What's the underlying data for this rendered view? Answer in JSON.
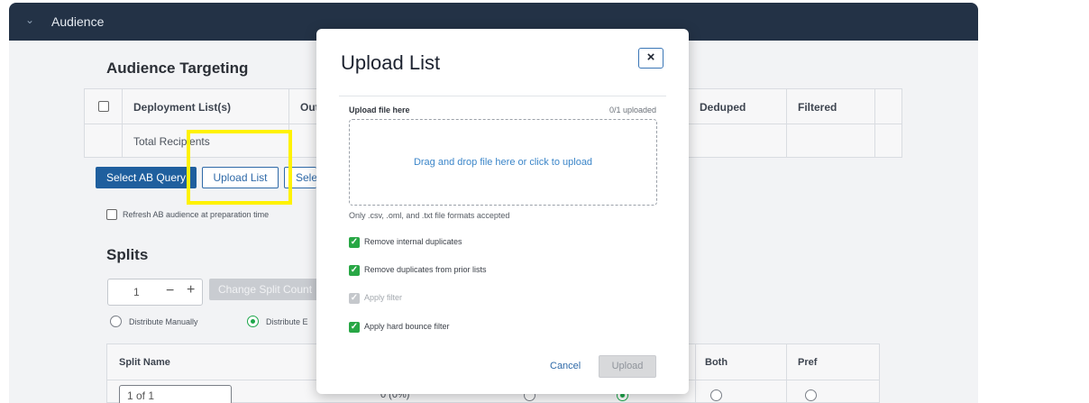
{
  "panel": {
    "title": "Audience"
  },
  "targeting": {
    "title": "Audience Targeting",
    "columns": [
      "Deployment List(s)",
      "Out",
      "Deduped",
      "Filtered"
    ],
    "row_label": "Total Recipients",
    "buttons": {
      "select_ab_query": "Select AB Query",
      "upload_list": "Upload List",
      "select_partial": "Sele"
    },
    "refresh_label": "Refresh AB audience at preparation time"
  },
  "splits": {
    "title": "Splits",
    "count_value": "1",
    "change_count_label": "Change Split Count",
    "distribute_manually": "Distribute Manually",
    "distribute_evenly_partial": "Distribute E",
    "columns": [
      "Split Name",
      "Both",
      "Pref"
    ],
    "first_split_name": "1 of 1",
    "first_split_pct": "0 (0%)"
  },
  "modal": {
    "title": "Upload List",
    "close_label": "×",
    "upload_label": "Upload file here",
    "upload_count": "0/1 uploaded",
    "dropzone_text": "Drag and drop file here or click to upload",
    "formats_text": "Only .csv, .oml, and .txt file formats accepted",
    "options": [
      {
        "label": "Remove internal duplicates",
        "checked": true,
        "disabled": false
      },
      {
        "label": "Remove duplicates from prior lists",
        "checked": true,
        "disabled": false
      },
      {
        "label": "Apply filter",
        "checked": true,
        "disabled": true
      },
      {
        "label": "Apply hard bounce filter",
        "checked": true,
        "disabled": false
      }
    ],
    "cancel_label": "Cancel",
    "upload_button": "Upload"
  },
  "colors": {
    "header_bg": "#233246",
    "primary": "#1f5f9e",
    "link": "#3c86c9",
    "check_green": "#28a745",
    "highlight": "#fff200"
  }
}
